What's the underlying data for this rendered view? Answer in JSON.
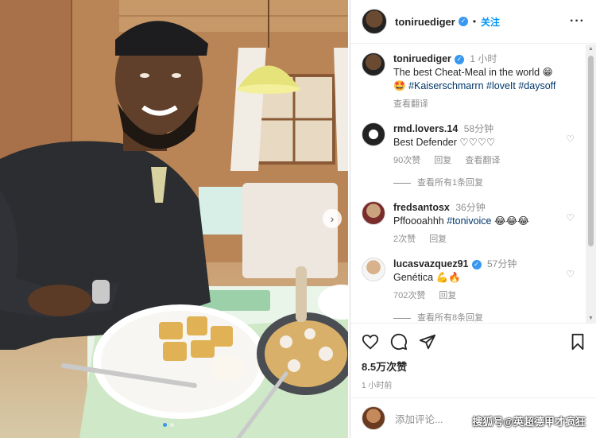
{
  "post": {
    "username": "toniruediger",
    "follow_label": "关注",
    "caption_time": "1 小时",
    "caption": "The best Cheat-Meal in the world 😁",
    "caption_line2_emoji": "🤩",
    "hashtags": [
      "#Kaiserschmarrn",
      "#loveIt",
      "#daysoff"
    ],
    "see_translation": "查看翻译"
  },
  "comments": [
    {
      "user": "rmd.lovers.14",
      "time": "58分钟",
      "text": "Best Defender ♡♡♡♡",
      "likes": "90次赞",
      "reply": "回复",
      "translate": "查看翻译",
      "view_replies": "查看所有1条回复"
    },
    {
      "user": "fredsantosx",
      "time": "36分钟",
      "text": "Pffoooahhh",
      "tag": "#tonivoice",
      "emoji": "😂😂😂",
      "likes": "2次赞",
      "reply": "回复"
    },
    {
      "user": "lucasvazquez91",
      "time": "57分钟",
      "text": "Genética 💪🔥",
      "likes": "702次赞",
      "reply": "回复",
      "view_replies": "查看所有8条回复"
    }
  ],
  "actions": {
    "likes": "8.5万次赞",
    "ago": "1 小时前"
  },
  "composer": {
    "placeholder": "添加评论..."
  },
  "watermark": "搜狐号@英超德甲才疯狂",
  "icons": {
    "more": "more-icon",
    "like": "heart-icon",
    "comment": "comment-icon",
    "share": "share-icon",
    "save": "bookmark-icon",
    "emoji": "emoji-icon",
    "next": "chevron-right-icon"
  },
  "colors": {
    "accent": "#0095f6",
    "verified": "#3897f0"
  }
}
